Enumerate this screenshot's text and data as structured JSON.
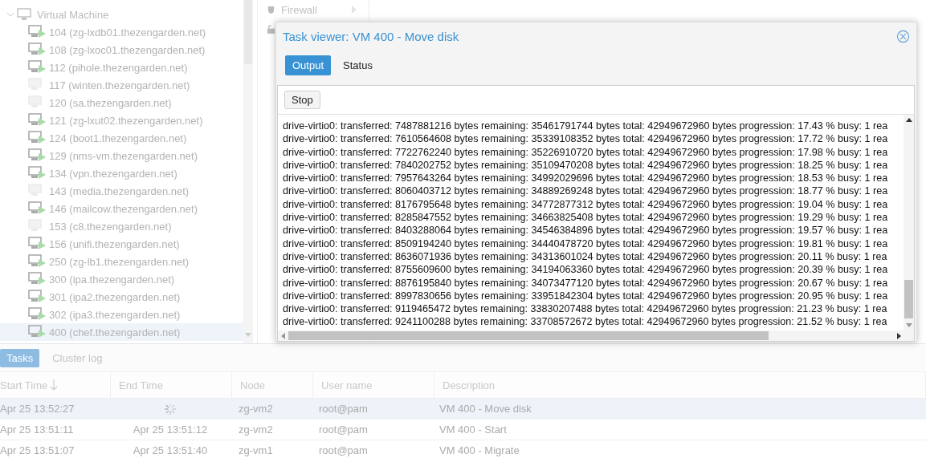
{
  "tree": {
    "label": "Virtual Machine",
    "expanded": true,
    "children": [
      {
        "label": "104 (zg-lxdb01.thezengarden.net)",
        "running": true,
        "selected": false
      },
      {
        "label": "108 (zg-lxoc01.thezengarden.net)",
        "running": true,
        "selected": false
      },
      {
        "label": "112 (pihole.thezengarden.net)",
        "running": true,
        "selected": false
      },
      {
        "label": "117 (winten.thezengarden.net)",
        "running": false,
        "selected": false
      },
      {
        "label": "120 (sa.thezengarden.net)",
        "running": false,
        "selected": false
      },
      {
        "label": "121 (zg-lxut02.thezengarden.net)",
        "running": true,
        "selected": false
      },
      {
        "label": "124 (boot1.thezengarden.net)",
        "running": true,
        "selected": false
      },
      {
        "label": "129 (nms-vm.thezengarden.net)",
        "running": true,
        "selected": false
      },
      {
        "label": "134 (vpn.thezengarden.net)",
        "running": true,
        "selected": false
      },
      {
        "label": "143 (media.thezengarden.net)",
        "running": false,
        "selected": false
      },
      {
        "label": "146 (mailcow.thezengarden.net)",
        "running": true,
        "selected": false
      },
      {
        "label": "153 (c8.thezengarden.net)",
        "running": false,
        "selected": false
      },
      {
        "label": "156 (unifi.thezengarden.net)",
        "running": true,
        "selected": false
      },
      {
        "label": "250 (zg-lb1.thezengarden.net)",
        "running": true,
        "selected": false
      },
      {
        "label": "300 (ipa.thezengarden.net)",
        "running": true,
        "selected": false
      },
      {
        "label": "301 (ipa2.thezengarden.net)",
        "running": true,
        "selected": false
      },
      {
        "label": "302 (ipa3.thezengarden.net)",
        "running": true,
        "selected": false
      },
      {
        "label": "400 (chef.thezengarden.net)",
        "running": true,
        "selected": true
      }
    ]
  },
  "nav": {
    "items": [
      {
        "label": "Firewall"
      }
    ]
  },
  "dialog": {
    "title": "Task viewer: VM 400 - Move disk",
    "tabs": [
      {
        "label": "Output",
        "selected": true
      },
      {
        "label": "Status",
        "selected": false
      }
    ],
    "stop_button": "Stop",
    "log": [
      "drive-virtio0: transferred: 7487881216 bytes remaining: 35461791744 bytes total: 42949672960 bytes progression: 17.43 % busy: 1 rea",
      "drive-virtio0: transferred: 7610564608 bytes remaining: 35339108352 bytes total: 42949672960 bytes progression: 17.72 % busy: 1 rea",
      "drive-virtio0: transferred: 7722762240 bytes remaining: 35226910720 bytes total: 42949672960 bytes progression: 17.98 % busy: 1 rea",
      "drive-virtio0: transferred: 7840202752 bytes remaining: 35109470208 bytes total: 42949672960 bytes progression: 18.25 % busy: 1 rea",
      "drive-virtio0: transferred: 7957643264 bytes remaining: 34992029696 bytes total: 42949672960 bytes progression: 18.53 % busy: 1 rea",
      "drive-virtio0: transferred: 8060403712 bytes remaining: 34889269248 bytes total: 42949672960 bytes progression: 18.77 % busy: 1 rea",
      "drive-virtio0: transferred: 8176795648 bytes remaining: 34772877312 bytes total: 42949672960 bytes progression: 19.04 % busy: 1 rea",
      "drive-virtio0: transferred: 8285847552 bytes remaining: 34663825408 bytes total: 42949672960 bytes progression: 19.29 % busy: 1 rea",
      "drive-virtio0: transferred: 8403288064 bytes remaining: 34546384896 bytes total: 42949672960 bytes progression: 19.57 % busy: 1 rea",
      "drive-virtio0: transferred: 8509194240 bytes remaining: 34440478720 bytes total: 42949672960 bytes progression: 19.81 % busy: 1 rea",
      "drive-virtio0: transferred: 8636071936 bytes remaining: 34313601024 bytes total: 42949672960 bytes progression: 20.11 % busy: 1 rea",
      "drive-virtio0: transferred: 8755609600 bytes remaining: 34194063360 bytes total: 42949672960 bytes progression: 20.39 % busy: 1 rea",
      "drive-virtio0: transferred: 8876195840 bytes remaining: 34073477120 bytes total: 42949672960 bytes progression: 20.67 % busy: 1 rea",
      "drive-virtio0: transferred: 8997830656 bytes remaining: 33951842304 bytes total: 42949672960 bytes progression: 20.95 % busy: 1 rea",
      "drive-virtio0: transferred: 9119465472 bytes remaining: 33830207488 bytes total: 42949672960 bytes progression: 21.23 % busy: 1 rea",
      "drive-virtio0: transferred: 9241100288 bytes remaining: 33708572672 bytes total: 42949672960 bytes progression: 21.52 % busy: 1 rea"
    ]
  },
  "tasks": {
    "tabs": [
      {
        "label": "Tasks",
        "selected": true
      },
      {
        "label": "Cluster log",
        "selected": false
      }
    ],
    "columns": [
      {
        "label": "Start Time",
        "sorted": true
      },
      {
        "label": "End Time",
        "sorted": false
      },
      {
        "label": "Node",
        "sorted": false
      },
      {
        "label": "User name",
        "sorted": false
      },
      {
        "label": "Description",
        "sorted": false
      }
    ],
    "rows": [
      {
        "start": "Apr 25 13:52:27",
        "running": true,
        "node": "zg-vm2",
        "user": "root@pam",
        "description": "VM 400 - Move disk",
        "selected": true
      },
      {
        "start": "Apr 25 13:51:11",
        "end": "Apr 25 13:51:12",
        "running": false,
        "node": "zg-vm2",
        "user": "root@pam",
        "description": "VM 400 - Start",
        "selected": false
      },
      {
        "start": "Apr 25 13:51:07",
        "end": "Apr 25 13:51:40",
        "running": false,
        "node": "zg-vm1",
        "user": "root@pam",
        "description": "VM 400 - Migrate",
        "selected": false
      }
    ]
  }
}
